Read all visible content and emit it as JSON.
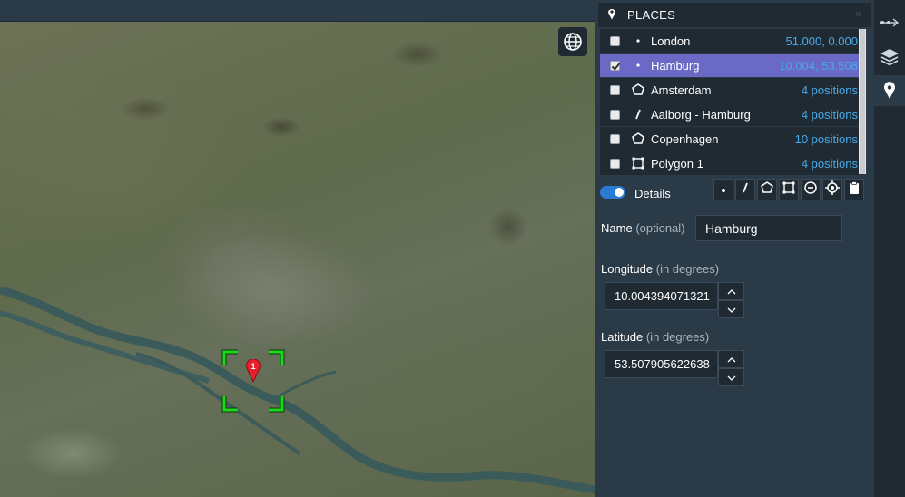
{
  "map": {
    "globe_icon": "globe-icon",
    "marker": {
      "label": "1",
      "color": "#e8202a"
    },
    "target_color": "#1bd81b"
  },
  "panel": {
    "title": "PLACES",
    "places": [
      {
        "name": "London",
        "value": "51.000, 0.000",
        "icon": "point-icon",
        "checked": false,
        "selected": false
      },
      {
        "name": "Hamburg",
        "value": "10.004, 53.508",
        "icon": "point-icon",
        "checked": true,
        "selected": true
      },
      {
        "name": "Amsterdam",
        "value": "4 positions",
        "icon": "polygon-icon",
        "checked": false,
        "selected": false
      },
      {
        "name": "Aalborg - Hamburg",
        "value": "4 positions",
        "icon": "line-icon",
        "checked": false,
        "selected": false
      },
      {
        "name": "Copenhagen",
        "value": "10 positions",
        "icon": "polygon-icon",
        "checked": false,
        "selected": false
      },
      {
        "name": "Polygon 1",
        "value": "4 positions",
        "icon": "rectangle-icon",
        "checked": false,
        "selected": false
      }
    ],
    "details": {
      "label": "Details",
      "enabled": true
    },
    "tools": [
      "point-icon",
      "line-icon",
      "polygon-icon",
      "rectangle-icon",
      "minus-circle-icon",
      "crosshair-icon",
      "clipboard-icon"
    ],
    "name_field": {
      "label": "Name",
      "hint": "(optional)",
      "value": "Hamburg"
    },
    "longitude_field": {
      "label": "Longitude",
      "hint": "(in degrees)",
      "value": "10.004394071321"
    },
    "latitude_field": {
      "label": "Latitude",
      "hint": "(in degrees)",
      "value": "53.507905622638"
    }
  },
  "sidebar": {
    "buttons": [
      "route-icon",
      "layers-icon",
      "place-pin-icon"
    ],
    "active": "place-pin-icon"
  },
  "colors": {
    "accent": "#6a69c6",
    "link": "#4aa8e8",
    "toggle": "#2a7bd4",
    "panel_bg": "#2b3a47",
    "dark_bg": "#1f2a33"
  }
}
